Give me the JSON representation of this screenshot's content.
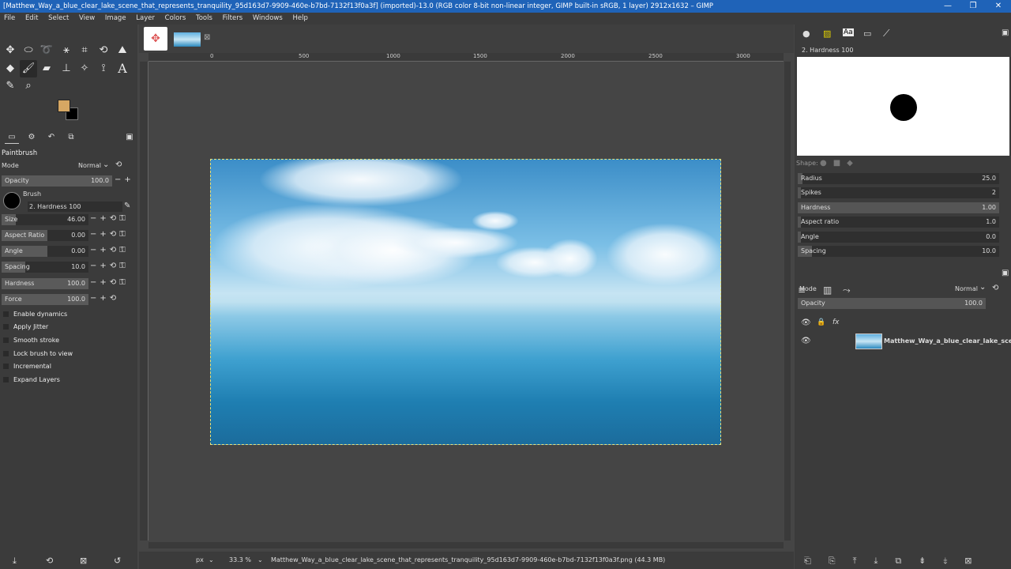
{
  "window": {
    "title": "[Matthew_Way_a_blue_clear_lake_scene_that_represents_tranquility_95d163d7-9909-460e-b7bd-7132f13f0a3f] (imported)-13.0 (RGB color 8-bit non-linear integer, GIMP built-in sRGB, 1 layer) 2912x1632 – GIMP",
    "minimize": "—",
    "maximize": "❐",
    "close": "✕"
  },
  "menu": [
    "File",
    "Edit",
    "Select",
    "View",
    "Image",
    "Layer",
    "Colors",
    "Tools",
    "Filters",
    "Windows",
    "Help"
  ],
  "tool_options": {
    "title": "Paintbrush",
    "mode_label": "Mode",
    "mode_value": "Normal",
    "opacity_label": "Opacity",
    "opacity_value": "100.0",
    "brush_label": "Brush",
    "brush_name": "2. Hardness 100",
    "size_label": "Size",
    "size_value": "46.00",
    "aspect_label": "Aspect Ratio",
    "aspect_value": "0.00",
    "angle_label": "Angle",
    "angle_value": "0.00",
    "spacing_label": "Spacing",
    "spacing_value": "10.0",
    "hardness_label": "Hardness",
    "hardness_value": "100.0",
    "force_label": "Force",
    "force_value": "100.0",
    "checks": [
      "Enable dynamics",
      "Apply Jitter",
      "Smooth stroke",
      "Lock brush to view",
      "Incremental",
      "Expand Layers"
    ]
  },
  "ruler_labels": [
    "0",
    "500",
    "1000",
    "1500",
    "2000",
    "2500",
    "3000"
  ],
  "status": {
    "unit": "px",
    "zoom": "33.3 %",
    "file": "Matthew_Way_a_blue_clear_lake_scene_that_represents_tranquility_95d163d7-9909-460e-b7bd-7132f13f0a3f.png (44.3 MB)"
  },
  "brushes": {
    "name": "2. Hardness 100",
    "shape_label": "Shape:",
    "radius_label": "Radius",
    "radius_value": "25.0",
    "spikes_label": "Spikes",
    "spikes_value": "2",
    "hardness_label": "Hardness",
    "hardness_value": "1.00",
    "aspect_label": "Aspect ratio",
    "aspect_value": "1.0",
    "angle_label": "Angle",
    "angle_value": "0.0",
    "spacing_label": "Spacing",
    "spacing_value": "10.0"
  },
  "layers": {
    "mode_label": "Mode",
    "mode_value": "Normal",
    "opacity_label": "Opacity",
    "opacity_value": "100.0",
    "layer_name": "Matthew_Way_a_blue_clear_lake_scene_that"
  },
  "colors": {
    "foreground": "#d6a763",
    "background": "#000000",
    "titlebar": "#1f63b8"
  }
}
